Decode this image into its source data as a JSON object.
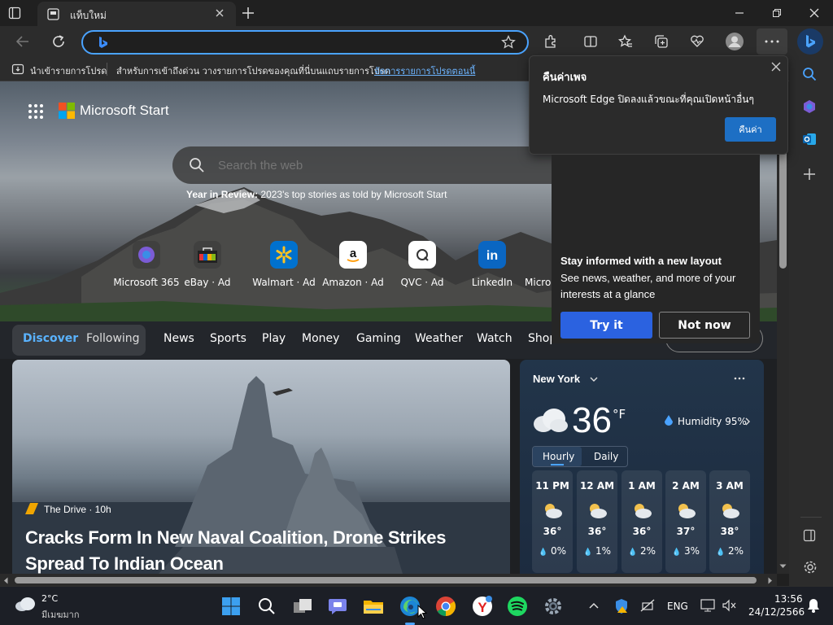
{
  "browser": {
    "tab_title": "แท็บใหม่",
    "address_value": "",
    "favorites": {
      "import_label": "นำเข้ารายการโปรด",
      "message": "สำหรับการเข้าถึงด่วน วางรายการโปรดของคุณที่นี่บนแถบรายการโปรด",
      "manage_link": "จัดการรายการโปรดตอนนี้"
    }
  },
  "start": {
    "brand": "Microsoft Start",
    "search_placeholder": "Search the web",
    "year_review_bold": "Year in Review:",
    "year_review_text": "2023's top stories as told by Microsoft Start",
    "quick_links": [
      {
        "label": "Microsoft 365"
      },
      {
        "label": "eBay · Ad"
      },
      {
        "label": "Walmart · Ad"
      },
      {
        "label": "Amazon · Ad"
      },
      {
        "label": "QVC · Ad"
      },
      {
        "label": "LinkedIn"
      },
      {
        "label": "Micro"
      }
    ],
    "nav": {
      "discover": "Discover",
      "following": "Following",
      "items": [
        "News",
        "Sports",
        "Play",
        "Money",
        "Gaming",
        "Weather",
        "Watch",
        "Shop"
      ]
    },
    "article": {
      "source": "The Drive · 10h",
      "headline_line1": "Cracks Form In New Naval Coalition, Drone Strikes",
      "headline_line2": "Spread To Indian Ocean"
    },
    "weather": {
      "location": "New York",
      "temp": "36",
      "unit": "°F",
      "humidity": "Humidity 95%",
      "tab_hourly": "Hourly",
      "tab_daily": "Daily",
      "hours": [
        {
          "time": "11 PM",
          "temp": "36°",
          "precip": "0%"
        },
        {
          "time": "12 AM",
          "temp": "36°",
          "precip": "1%"
        },
        {
          "time": "1 AM",
          "temp": "36°",
          "precip": "2%"
        },
        {
          "time": "2 AM",
          "temp": "37°",
          "precip": "3%"
        },
        {
          "time": "3 AM",
          "temp": "38°",
          "precip": "2%"
        }
      ]
    }
  },
  "restore_popup": {
    "title": "คืนค่าเพจ",
    "message": "Microsoft Edge ปิดลงแล้วขณะที่คุณเปิดหน้าอื่นๆ",
    "button": "คืนค่า"
  },
  "layout_popup": {
    "title": "Stay informed with a new layout",
    "body_line1": "See news, weather, and more of your",
    "body_line2": "interests at a glance",
    "try_label": "Try it",
    "not_now_label": "Not now"
  },
  "taskbar": {
    "weather_temp": "2°C",
    "weather_desc": "มีเมฆมาก",
    "language": "ENG",
    "time": "13:56",
    "date": "24/12/2566"
  },
  "colors": {
    "accent": "#4aa3ff",
    "try_button": "#2b62e0",
    "restore_button": "#1d6fc4"
  }
}
